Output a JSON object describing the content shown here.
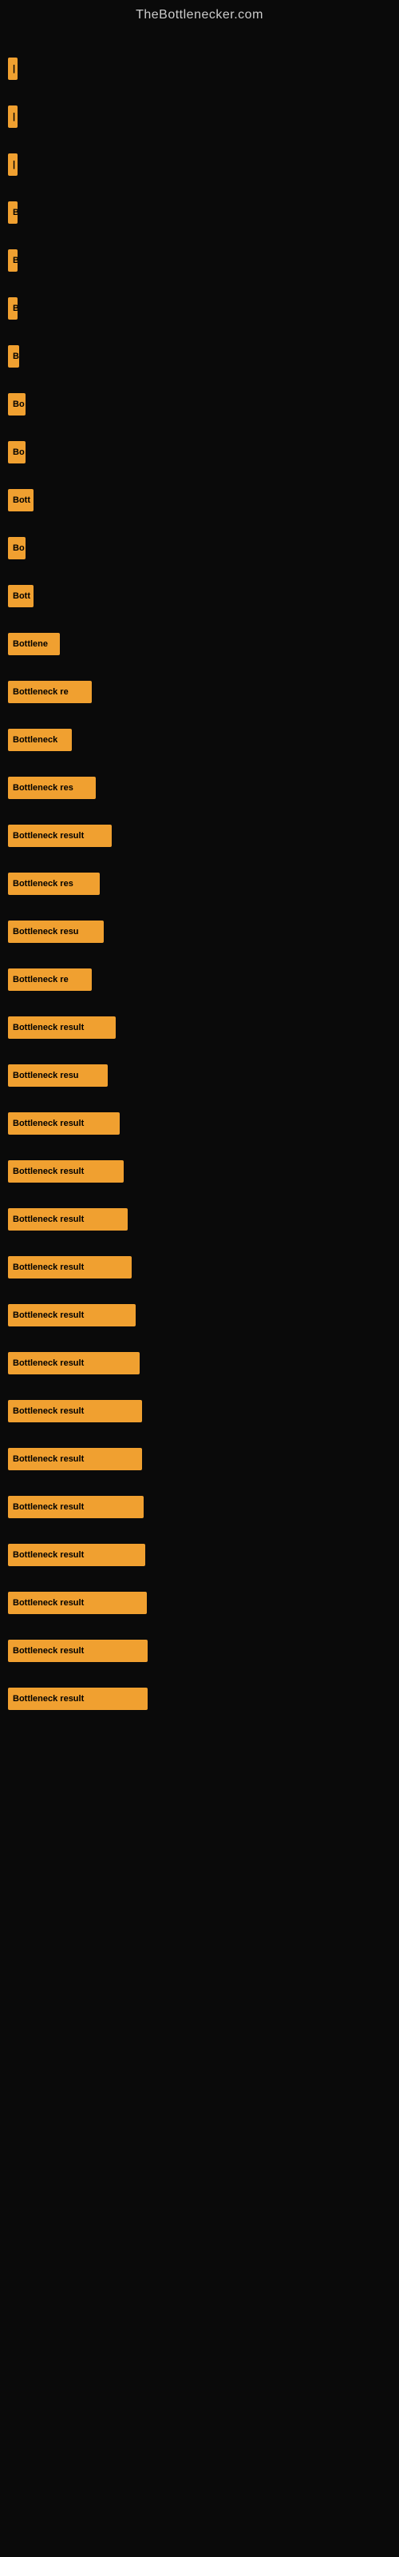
{
  "site": {
    "title": "TheBottlenecker.com"
  },
  "bars": [
    {
      "id": 1,
      "label": "|",
      "width": 4
    },
    {
      "id": 2,
      "label": "|",
      "width": 4
    },
    {
      "id": 3,
      "label": "|",
      "width": 4
    },
    {
      "id": 4,
      "label": "B",
      "width": 10
    },
    {
      "id": 5,
      "label": "B",
      "width": 10
    },
    {
      "id": 6,
      "label": "B",
      "width": 10
    },
    {
      "id": 7,
      "label": "B",
      "width": 14
    },
    {
      "id": 8,
      "label": "Bo",
      "width": 22
    },
    {
      "id": 9,
      "label": "Bo",
      "width": 22
    },
    {
      "id": 10,
      "label": "Bott",
      "width": 32
    },
    {
      "id": 11,
      "label": "Bo",
      "width": 22
    },
    {
      "id": 12,
      "label": "Bott",
      "width": 32
    },
    {
      "id": 13,
      "label": "Bottlene",
      "width": 65
    },
    {
      "id": 14,
      "label": "Bottleneck re",
      "width": 105
    },
    {
      "id": 15,
      "label": "Bottleneck",
      "width": 80
    },
    {
      "id": 16,
      "label": "Bottleneck res",
      "width": 110
    },
    {
      "id": 17,
      "label": "Bottleneck result",
      "width": 130
    },
    {
      "id": 18,
      "label": "Bottleneck res",
      "width": 115
    },
    {
      "id": 19,
      "label": "Bottleneck resu",
      "width": 120
    },
    {
      "id": 20,
      "label": "Bottleneck re",
      "width": 105
    },
    {
      "id": 21,
      "label": "Bottleneck result",
      "width": 135
    },
    {
      "id": 22,
      "label": "Bottleneck resu",
      "width": 125
    },
    {
      "id": 23,
      "label": "Bottleneck result",
      "width": 140
    },
    {
      "id": 24,
      "label": "Bottleneck result",
      "width": 145
    },
    {
      "id": 25,
      "label": "Bottleneck result",
      "width": 150
    },
    {
      "id": 26,
      "label": "Bottleneck result",
      "width": 155
    },
    {
      "id": 27,
      "label": "Bottleneck result",
      "width": 160
    },
    {
      "id": 28,
      "label": "Bottleneck result",
      "width": 165
    },
    {
      "id": 29,
      "label": "Bottleneck result",
      "width": 168
    },
    {
      "id": 30,
      "label": "Bottleneck result",
      "width": 168
    },
    {
      "id": 31,
      "label": "Bottleneck result",
      "width": 170
    },
    {
      "id": 32,
      "label": "Bottleneck result",
      "width": 172
    },
    {
      "id": 33,
      "label": "Bottleneck result",
      "width": 174
    },
    {
      "id": 34,
      "label": "Bottleneck result",
      "width": 175
    },
    {
      "id": 35,
      "label": "Bottleneck result",
      "width": 175
    }
  ]
}
